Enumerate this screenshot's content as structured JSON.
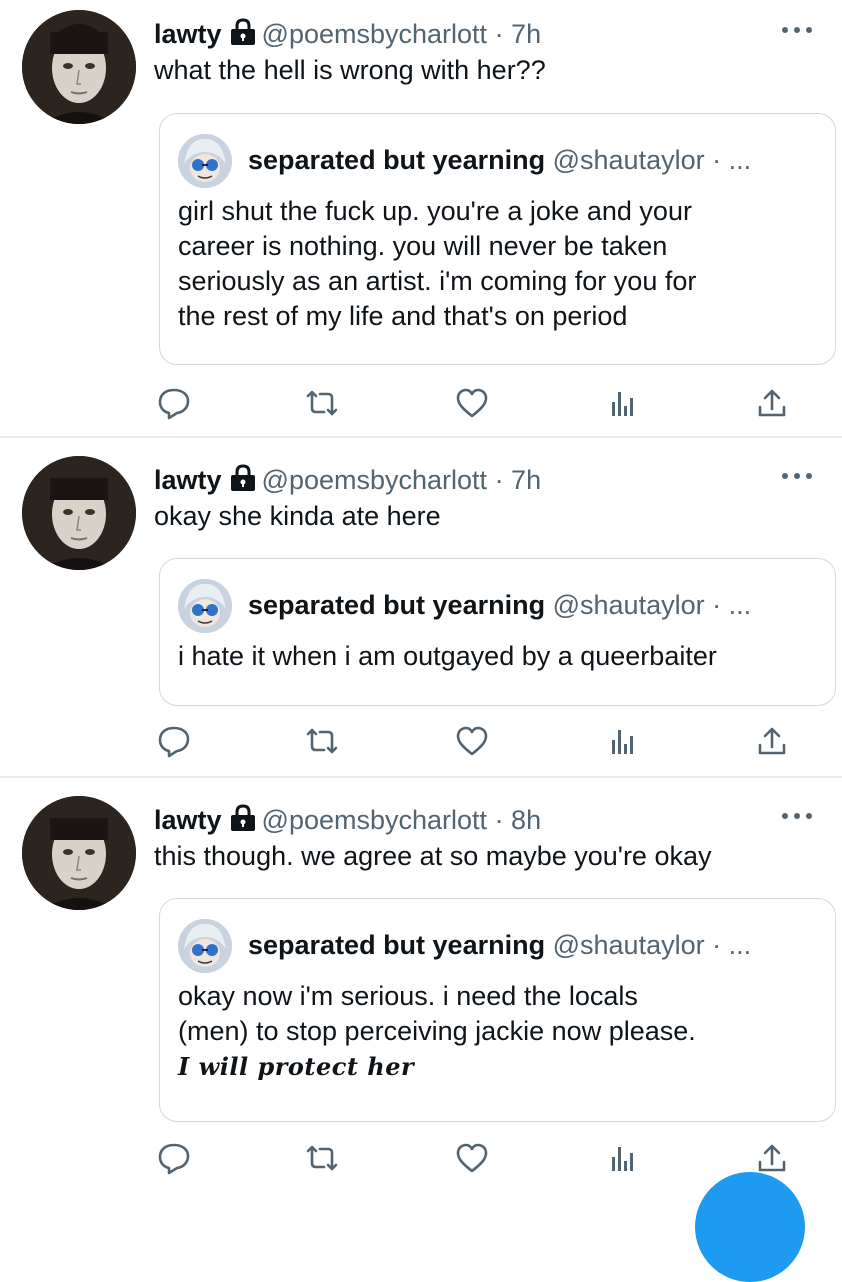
{
  "colors": {
    "accent": "#1d9bf0",
    "text": "#0f1419",
    "muted": "#536471",
    "border": "#d4d9dd"
  },
  "tweets": [
    {
      "name": "lawty",
      "handle": "@poemsbycharlott",
      "time": "· 7h",
      "text": "what the hell is wrong with her??",
      "quote": {
        "name": "separated but yearning",
        "handle": "@shautaylor",
        "suffix": "· ...",
        "lines": [
          "girl shut the fuck up. you're a joke and your",
          "career is nothing. you will never be taken",
          "seriously as an artist. i'm coming for you for",
          "the rest of my life and that's on period"
        ]
      }
    },
    {
      "name": "lawty",
      "handle": "@poemsbycharlott",
      "time": "· 7h",
      "text": "okay she kinda ate here",
      "quote": {
        "name": "separated but yearning",
        "handle": "@shautaylor",
        "suffix": "· ...",
        "lines": [
          "i hate it when i am outgayed by a queerbaiter"
        ]
      }
    },
    {
      "name": "lawty",
      "handle": "@poemsbycharlott",
      "time": "· 8h",
      "text": "this though. we agree at so maybe you're okay",
      "quote": {
        "name": "separated but yearning",
        "handle": "@shautaylor",
        "suffix": "· ...",
        "lines": [
          "okay now i'm serious. i need the locals",
          "(men) to stop perceiving jackie now please.",
          "I will protect her"
        ]
      }
    }
  ],
  "icons": [
    "more-icon",
    "lock-icon",
    "reply-icon",
    "retweet-icon",
    "like-icon",
    "analytics-icon",
    "share-icon",
    "compose-fab"
  ]
}
